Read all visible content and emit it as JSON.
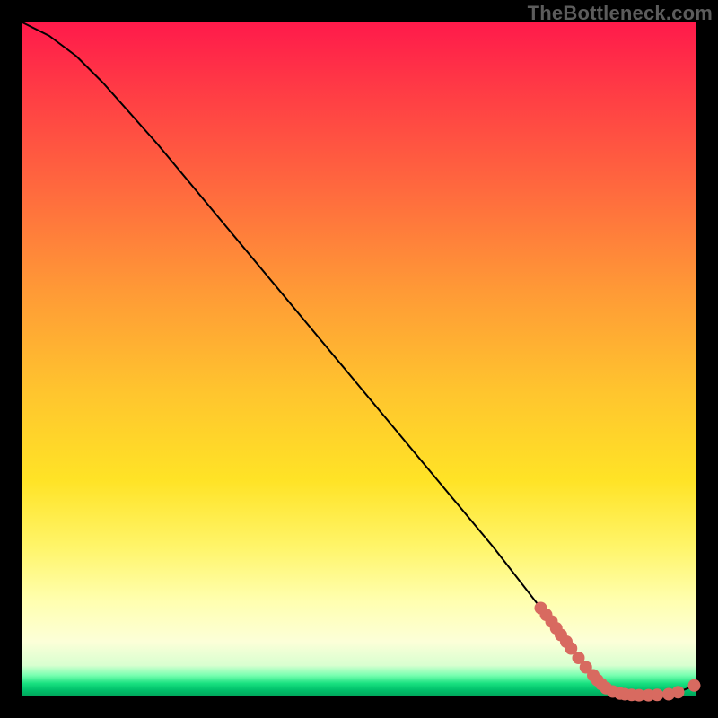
{
  "watermark": "TheBottleneck.com",
  "chart_data": {
    "type": "line",
    "title": "",
    "xlabel": "",
    "ylabel": "",
    "xlim": [
      0,
      100
    ],
    "ylim": [
      0,
      100
    ],
    "grid": false,
    "series": [
      {
        "name": "bottleneck-curve",
        "x": [
          0,
          4,
          8,
          12,
          20,
          30,
          40,
          50,
          60,
          70,
          77,
          80,
          84,
          88,
          92,
          96,
          100
        ],
        "y": [
          100,
          98,
          95,
          91,
          82,
          70,
          58,
          46,
          34,
          22,
          13,
          9,
          4,
          1,
          0,
          0,
          1.5
        ],
        "color": "#000000",
        "lineWidth": 2
      }
    ],
    "markers": [
      {
        "name": "highlight-dots",
        "color": "#d86a60",
        "radius": 7,
        "points": [
          {
            "x": 77.0,
            "y": 13.0
          },
          {
            "x": 77.8,
            "y": 12.0
          },
          {
            "x": 78.6,
            "y": 11.0
          },
          {
            "x": 79.3,
            "y": 10.0
          },
          {
            "x": 80.0,
            "y": 9.0
          },
          {
            "x": 80.8,
            "y": 8.0
          },
          {
            "x": 81.5,
            "y": 7.0
          },
          {
            "x": 82.6,
            "y": 5.6
          },
          {
            "x": 83.7,
            "y": 4.2
          },
          {
            "x": 84.8,
            "y": 3.0
          },
          {
            "x": 85.4,
            "y": 2.3
          },
          {
            "x": 86.0,
            "y": 1.7
          },
          {
            "x": 86.7,
            "y": 1.1
          },
          {
            "x": 87.7,
            "y": 0.6
          },
          {
            "x": 88.8,
            "y": 0.3
          },
          {
            "x": 89.5,
            "y": 0.2
          },
          {
            "x": 90.5,
            "y": 0.1
          },
          {
            "x": 91.6,
            "y": 0.05
          },
          {
            "x": 93.0,
            "y": 0.05
          },
          {
            "x": 94.3,
            "y": 0.1
          },
          {
            "x": 96.0,
            "y": 0.2
          },
          {
            "x": 97.4,
            "y": 0.5
          },
          {
            "x": 99.8,
            "y": 1.5
          }
        ]
      }
    ]
  }
}
